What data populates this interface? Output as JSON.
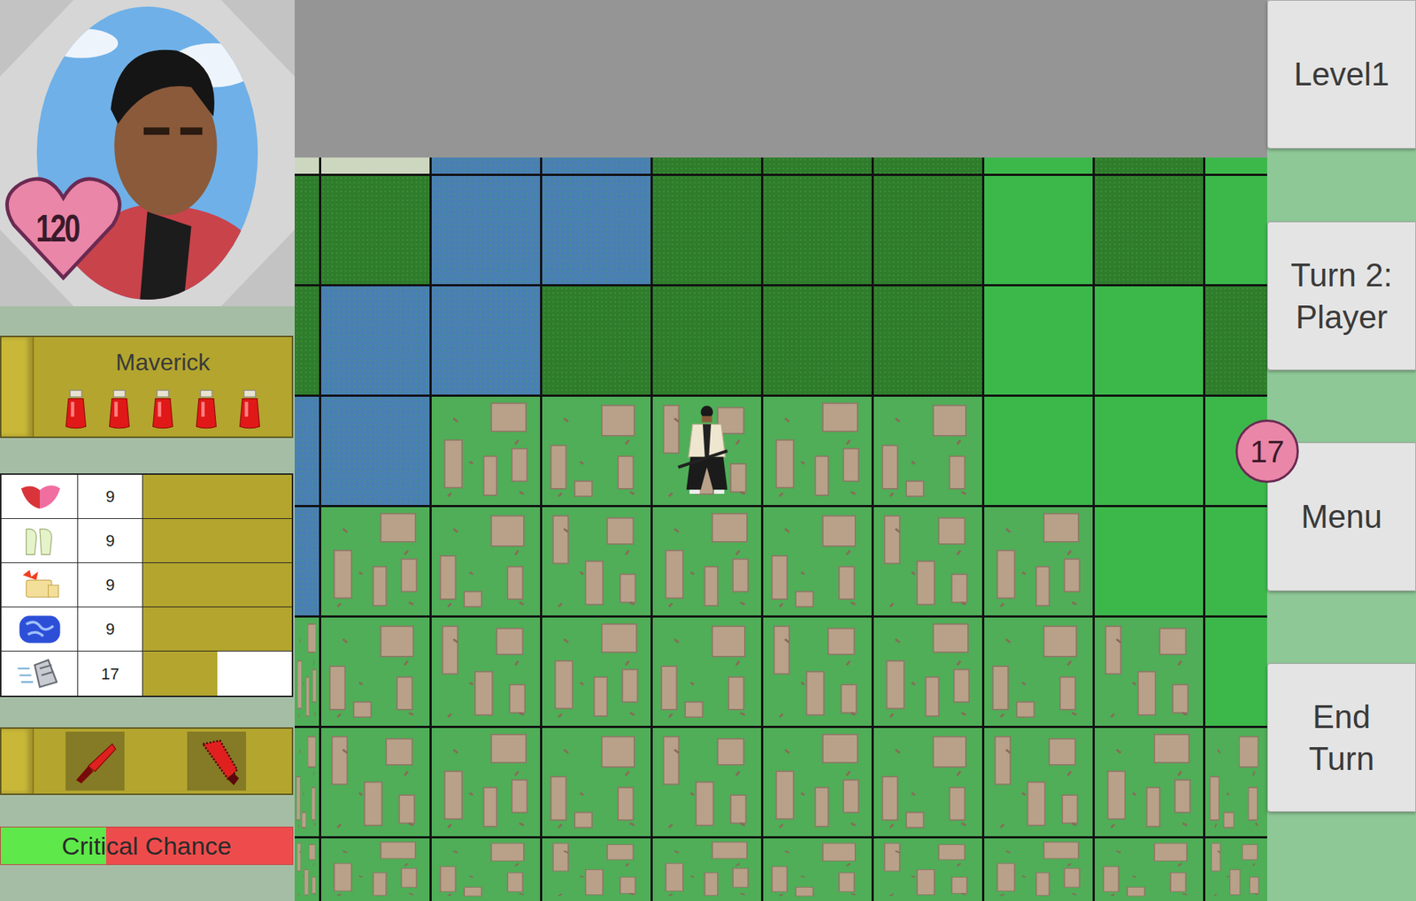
{
  "level": "Level1",
  "turn": "Turn 2: Player",
  "menu": "Menu",
  "end_turn": "End Turn",
  "moves_badge": "17",
  "character": {
    "name": "Maverick",
    "hp": "120",
    "potions": [
      {
        "full": true
      },
      {
        "full": true
      },
      {
        "full": true
      },
      {
        "full": true
      },
      {
        "full": true
      }
    ]
  },
  "stats": [
    {
      "kind": "defense",
      "value": "9",
      "level": 1
    },
    {
      "kind": "health",
      "value": "9",
      "level": 1
    },
    {
      "kind": "attack",
      "value": "9",
      "level": 1
    },
    {
      "kind": "magic",
      "value": "9",
      "level": 1
    },
    {
      "kind": "speed",
      "value": "17",
      "level": 0.5
    }
  ],
  "weapons": [
    {
      "kind": "knife"
    },
    {
      "kind": "saw"
    }
  ],
  "critical_chance": {
    "label": "Critical Chance",
    "level": 0.36
  },
  "map": {
    "rows": [
      [
        "pale",
        "pale",
        "water",
        "water",
        "dark",
        "dark",
        "dark",
        "light",
        "dark",
        "light"
      ],
      [
        "dark",
        "dark",
        "water",
        "water",
        "dark",
        "dark",
        "dark",
        "light",
        "dark",
        "light"
      ],
      [
        "dark",
        "water",
        "water",
        "dark",
        "dark",
        "dark",
        "dark",
        "light",
        "light",
        "dark"
      ],
      [
        "water",
        "water",
        "ruins",
        "ruins",
        "ruins",
        "ruins",
        "ruins",
        "light",
        "light",
        "light"
      ],
      [
        "water",
        "ruins",
        "ruins",
        "ruins",
        "ruins",
        "ruins",
        "ruins",
        "ruins",
        "light",
        "light"
      ],
      [
        "ruins",
        "ruins",
        "ruins",
        "ruins",
        "ruins",
        "ruins",
        "ruins",
        "ruins",
        "ruins",
        "light"
      ],
      [
        "ruins",
        "ruins",
        "ruins",
        "ruins",
        "ruins",
        "ruins",
        "ruins",
        "ruins",
        "ruins",
        "ruins"
      ],
      [
        "ruins",
        "ruins",
        "ruins",
        "ruins",
        "ruins",
        "ruins",
        "ruins",
        "ruins",
        "ruins",
        "ruins"
      ]
    ],
    "unit": {
      "row": 3,
      "col": 4
    }
  }
}
